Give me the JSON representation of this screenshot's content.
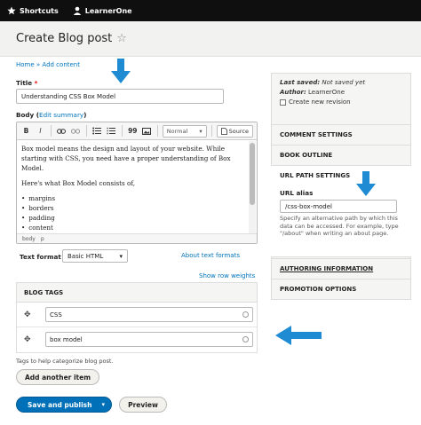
{
  "toolbar": {
    "shortcuts": "Shortcuts",
    "user": "LearnerOne"
  },
  "page": {
    "title": "Create Blog post",
    "star_icon": "star-outline-icon",
    "breadcrumb": "Home » Add content"
  },
  "form": {
    "title_label": "Title",
    "title_required": "*",
    "title_value": "Understanding CSS Box Model",
    "body_label": "Body (",
    "edit_summary": "Edit summary",
    "body_label_end": ")",
    "editor_toolbar": {
      "bold": "B",
      "italic": "I",
      "quote": "99",
      "format": "Normal",
      "source": "Source"
    },
    "body_paragraph1": "Box model means the design and layout of your website. While starting with CSS, you need have a proper understanding of Box Model.",
    "body_paragraph2": "Here's what Box Model consists of,",
    "body_list": [
      "margins",
      "borders",
      "padding",
      "content"
    ],
    "editor_path": [
      "body",
      "p"
    ],
    "text_format_label": "Text format",
    "text_format_value": "Basic HTML",
    "about_formats": "About text formats",
    "show_row_weights": "Show row weights",
    "tags_header": "BLOG TAGS",
    "tags": [
      "CSS",
      "box model"
    ],
    "tags_help": "Tags to help categorize blog post.",
    "add_another": "Add another item",
    "save_publish": "Save and publish",
    "preview": "Preview"
  },
  "sidebar": {
    "last_saved_label": "Last saved:",
    "last_saved_value": "Not saved yet",
    "author_label": "Author:",
    "author_value": "LearnerOne",
    "new_revision": "Create new revision",
    "comment_settings": "COMMENT SETTINGS",
    "book_outline": "BOOK OUTLINE",
    "url_path_settings": "URL PATH SETTINGS",
    "url_alias_label": "URL alias",
    "url_alias_value": "/css-box-model",
    "url_alias_desc": "Specify an alternative path by which this data can be accessed. For example, type \"/about\" when writing an about page.",
    "authoring_info": "AUTHORING INFORMATION",
    "promotion_options": "PROMOTION OPTIONS"
  },
  "colors": {
    "accent": "#0071b8",
    "arrow": "#1e8bd3",
    "toolbar_bg": "#0f0f0f"
  }
}
